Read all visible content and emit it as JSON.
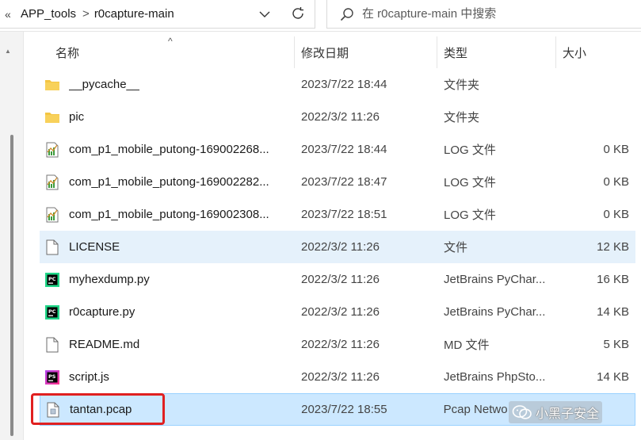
{
  "address_bar": {
    "more_glyph": "«",
    "breadcrumbs": [
      "APP_tools",
      "r0capture-main"
    ],
    "separator": ">"
  },
  "search": {
    "placeholder": "在 r0capture-main 中搜索"
  },
  "columns": {
    "name": "名称",
    "date": "修改日期",
    "type": "类型",
    "size": "大小"
  },
  "files": [
    {
      "icon": "folder-icon",
      "name": "__pycache__",
      "date": "2023/7/22 18:44",
      "type": "文件夹",
      "size": ""
    },
    {
      "icon": "folder-icon",
      "name": "pic",
      "date": "2022/3/2 11:26",
      "type": "文件夹",
      "size": ""
    },
    {
      "icon": "log-file-icon",
      "name": "com_p1_mobile_putong-169002268...",
      "date": "2023/7/22 18:44",
      "type": "LOG 文件",
      "size": "0 KB"
    },
    {
      "icon": "log-file-icon",
      "name": "com_p1_mobile_putong-169002282...",
      "date": "2023/7/22 18:47",
      "type": "LOG 文件",
      "size": "0 KB"
    },
    {
      "icon": "log-file-icon",
      "name": "com_p1_mobile_putong-169002308...",
      "date": "2023/7/22 18:51",
      "type": "LOG 文件",
      "size": "0 KB"
    },
    {
      "icon": "blank-file-icon",
      "name": "LICENSE",
      "date": "2022/3/2 11:26",
      "type": "文件",
      "size": "12 KB"
    },
    {
      "icon": "pycharm-file-icon",
      "name": "myhexdump.py",
      "date": "2022/3/2 11:26",
      "type": "JetBrains PyChar...",
      "size": "16 KB"
    },
    {
      "icon": "pycharm-file-icon",
      "name": "r0capture.py",
      "date": "2022/3/2 11:26",
      "type": "JetBrains PyChar...",
      "size": "14 KB"
    },
    {
      "icon": "blank-file-icon",
      "name": "README.md",
      "date": "2022/3/2 11:26",
      "type": "MD 文件",
      "size": "5 KB"
    },
    {
      "icon": "phpstorm-file-icon",
      "name": "script.js",
      "date": "2022/3/2 11:26",
      "type": "JetBrains PhpSto...",
      "size": "14 KB"
    },
    {
      "icon": "pcap-file-icon",
      "name": "tantan.pcap",
      "date": "2023/7/22 18:55",
      "type": "Pcap Netwo",
      "size": ""
    }
  ],
  "watermark": {
    "text": "小黑子安全"
  },
  "colors": {
    "selected_bg": "#cce8ff",
    "hover_bg": "#e5f1fb",
    "annotation_red": "#e02020",
    "folder": "#f4c542"
  }
}
